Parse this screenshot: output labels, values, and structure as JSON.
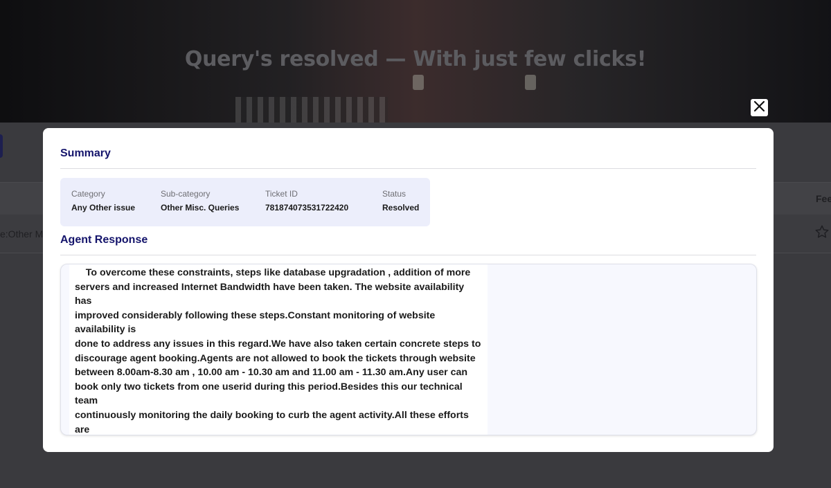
{
  "hero": {
    "title": "Query's resolved — With just few clicks!"
  },
  "background": {
    "row_fragment": "e:Other Mi",
    "header_fragment": "Fee"
  },
  "modal": {
    "summary_title": "Summary",
    "summary": [
      {
        "label": "Category",
        "value": "Any Other issue"
      },
      {
        "label": "Sub-category",
        "value": "Other Misc. Queries"
      },
      {
        "label": "Ticket ID",
        "value": "781874073531722420"
      },
      {
        "label": "Status",
        "value": "Resolved"
      }
    ],
    "agent_response_title": "Agent Response",
    "agent_response_text": "    To overcome these constraints, steps like database upgradation , addition of more\nservers and increased Internet Bandwidth have been taken. The website availability has\nimproved considerably following these steps.Constant monitoring of website availability is\ndone to address any issues in this regard.We have also taken certain concrete steps to\ndiscourage agent booking.Agents are not allowed to book the tickets through website\nbetween 8.00am-8.30 am , 10.00 am - 10.30 am and 11.00 am - 11.30 am.Any user can\nbook only two tickets from one userid during this period.Besides this our technical team\ncontinuously monitoring the daily booking to curb the agent activity.All these efforts are\ntaken just\nto make website approachable by common man."
  },
  "icons": {
    "close": "close-icon",
    "rating": "star-icon"
  },
  "colors": {
    "accent": "#14146b",
    "summary_bg": "#eceefb"
  }
}
